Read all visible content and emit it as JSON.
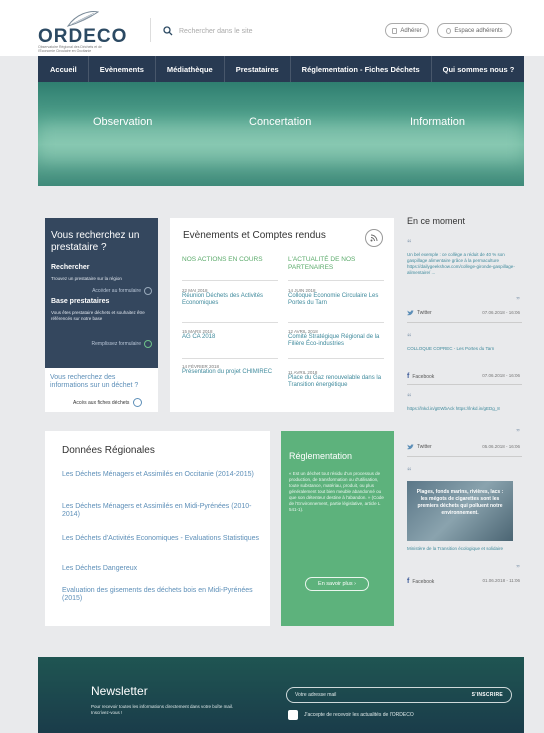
{
  "brand": {
    "name": "ORDECO",
    "tagline": "Observatoire Régional des Déchets et de l'Économie Circulaire en Occitanie"
  },
  "search": {
    "placeholder": "Rechercher dans le site"
  },
  "header_buttons": {
    "join": "Adhérer",
    "members": "Espace adhérents"
  },
  "nav": {
    "items": [
      "Accueil",
      "Evènements",
      "Médiathèque",
      "Prestataires",
      "Réglementation - Fiches Déchets",
      "Qui sommes nous ?"
    ]
  },
  "hero": {
    "words": [
      "Observation",
      "Concertation",
      "Information"
    ]
  },
  "provider_panel": {
    "title": "Vous recherchez un prestataire ?",
    "search_heading": "Rechercher",
    "search_text": "Trouvez un prestataire sur la région",
    "search_link": "Accéder au formulaire",
    "base_heading": "Base prestataires",
    "base_text": "Vous êtes prestataire déchets et souhaitez être référencés sur notre base",
    "base_link": "Remplissez formulaire"
  },
  "waste_panel": {
    "title": "Vous recherchez des informations sur un déchet ?",
    "link": "Accès aux fiches déchets"
  },
  "events": {
    "title": "Evènements et Comptes rendus",
    "left_heading": "NOS ACTIONS EN COURS",
    "right_heading": "L'ACTUALITÉ DE NOS PARTENAIRES",
    "left_items": [
      {
        "date": "22 MAI 2018",
        "label": "Réunion Déchets des Activités Economiques"
      },
      {
        "date": "15 MARS 2018",
        "label": "AG CA 2018"
      },
      {
        "date": "14 FÉVRIER 2018",
        "label": "Présentation du projet CHIMIREC"
      }
    ],
    "right_items": [
      {
        "date": "14 JUIN 2018",
        "label": "Colloque Economie Circulaire Les Portes du Tarn"
      },
      {
        "date": "12 AVRIL 2018",
        "label": "Comité Stratégique Régional de la Filière Éco-industries"
      },
      {
        "date": "11 AVRIL 2018",
        "label": "Place du Gaz renouvelable dans la Transition énergétique"
      }
    ]
  },
  "moment": {
    "title": "En ce moment",
    "posts": [
      {
        "text": "Un bel exemple : ce collège a réduit de 40 % son gaspillage alimentaire grâce à la permaculture https://dailygeekshow.com/college-gironde-gaspillage-alimentaire/ ...",
        "source": "Twitter",
        "date": "07.06.2018 - 16:06",
        "source_icon": "twitter-icon"
      },
      {
        "text": "COLLOQUE COPREC - Les Portes du Tarn",
        "source": "Facebook",
        "date": "07.06.2018 - 16:06",
        "source_icon": "facebook-icon"
      },
      {
        "text": "https://lnkd.in/gEWbAck https://lnkd.in/gEDg_8",
        "source": "Twitter",
        "date": "05.06.2018 - 16:06",
        "source_icon": "twitter-icon"
      },
      {
        "text": "Ministère de la Transition écologique et solidaire",
        "source": "Facebook",
        "date": "01.06.2018 - 11:06",
        "source_icon": "facebook-icon"
      }
    ],
    "image_caption": "Plages, fonds marins, rivières, lacs : les mégots de cigarettes sont les premiers déchets qui polluent notre environnement."
  },
  "regional": {
    "title": "Données Régionales",
    "links": [
      "Les Déchets Ménagers et Assimilés en Occitanie (2014-2015)",
      "Les Déchets Ménagers et Assimilés en Midi-Pyrénées (2010-2014)",
      "Les Déchets d'Activités Economiques - Evaluations Statistiques",
      "Les Déchets Dangereux",
      "Evaluation des gisements des déchets bois en Midi-Pyrénées (2015)"
    ]
  },
  "reglementation": {
    "title": "Réglementation",
    "text": "« Est un déchet tout résidu d'un processus de production, de transformation ou d'utilisation, toute substance, matériau, produit, ou plus généralement tout bien meuble abandonné ou que son détenteur destine à l'abandon. » (Code de l'Environnement, partie législative, article L 541-1).",
    "button": "En savoir plus ›"
  },
  "newsletter": {
    "title": "Newsletter",
    "subtitle": "Pour recevoir toutes les informations directement dans votre boîte mail. Inscrivez-vous !",
    "placeholder": "Votre adresse mail",
    "button": "S'INSCRIRE",
    "consent": "J'accepte de recevoir les actualités de l'ORDECO"
  },
  "colors": {
    "nav_bg": "#283a52",
    "panel_blue": "#34475e",
    "green_panel": "#5db27c",
    "link_blue": "#5d8fb8",
    "link_teal": "#3f8a9c"
  }
}
